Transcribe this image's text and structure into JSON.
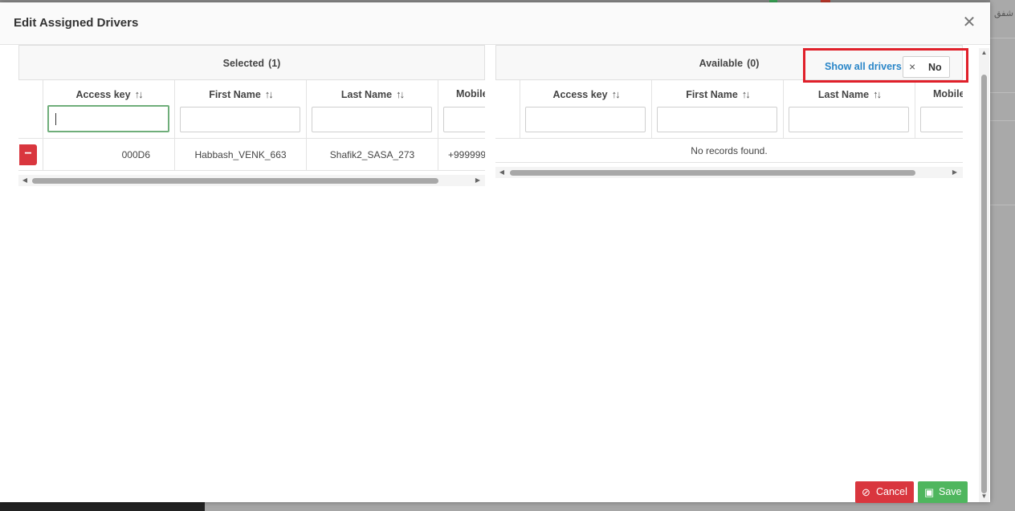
{
  "dialog": {
    "title": "Edit Assigned Drivers",
    "close_icon": "close-icon"
  },
  "selected": {
    "title": "Selected",
    "count": "(1)",
    "columns": [
      "Access key",
      "First Name",
      "Last Name",
      "Mobile"
    ],
    "sort_icon": "↑↓",
    "rows": [
      {
        "access_key": "000D6",
        "first_name": "Habbash_VENK_663",
        "last_name": "Shafik2_SASA_273",
        "mobile": "+999999"
      }
    ],
    "remove_icon": "minus-icon"
  },
  "available": {
    "title": "Available",
    "count": "(0)",
    "columns": [
      "Access key",
      "First Name",
      "Last Name",
      "Mobile"
    ],
    "empty_message": "No records found."
  },
  "show_all": {
    "label": "Show all drivers",
    "toggle_icon": "×",
    "toggle_value": "No",
    "highlight_color": "#e0202a"
  },
  "footer": {
    "cancel_label": "Cancel",
    "save_label": "Save",
    "cancel_color": "#d9363e",
    "save_color": "#4fb65e"
  },
  "background": {
    "corner_text": "شفق"
  }
}
